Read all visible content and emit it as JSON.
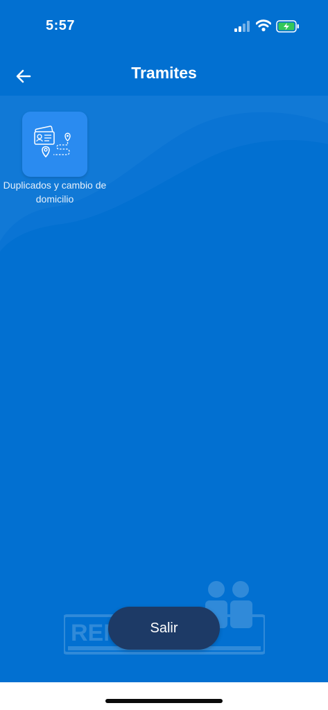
{
  "status_bar": {
    "time": "5:57",
    "icons": [
      "signal-icon",
      "wifi-icon",
      "battery-charging-icon"
    ]
  },
  "app_bar": {
    "title": "Tramites",
    "back_icon": "arrow-left-icon"
  },
  "tiles": [
    {
      "label": "Duplicados y cambio de domicilio",
      "icon": "id-card-location-icon"
    }
  ],
  "exit_button": {
    "label": "Salir"
  },
  "watermark": {
    "text": "RENAPER",
    "icon": "agency-logo"
  },
  "colors": {
    "background": "#0270d1",
    "tile": "#2a8bf0",
    "exit_button": "#1d3a66",
    "battery": "#34c759"
  }
}
